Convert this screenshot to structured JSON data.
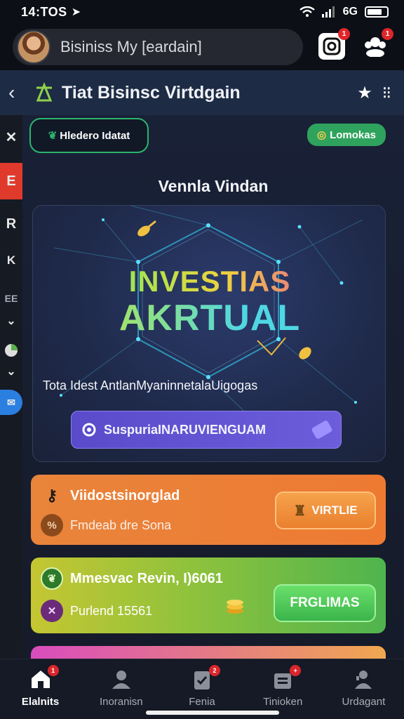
{
  "status": {
    "time": "14:TOS",
    "network": "6G"
  },
  "top_bar": {
    "search_text": "Bisiniss My [eardain]",
    "notif_badge": "1",
    "people_badge": "1"
  },
  "header": {
    "title": "Tiat Bisinsc Virtdgain"
  },
  "left_rail": {
    "items": [
      "K",
      "E",
      "R",
      "K",
      "EE"
    ]
  },
  "chips": {
    "left": "Hledero Idatat",
    "right": "Lomokas"
  },
  "section_title": "Vennla Vindan",
  "hero": {
    "line1": "INVESTIAS",
    "line2": "AKRTUAL",
    "subtitle": "Tota Idest AntlanMyaninnetalaUigogas",
    "button_label": "SuspuriaINARUVIENGUAM"
  },
  "cards": [
    {
      "title": "Viidostsinorglad",
      "subtitle": "Fmdeab dre Sona",
      "button": "VIRTLIE",
      "color": "#ee7a32"
    },
    {
      "title": "Mmesvac Revin, I)6061",
      "subtitle": "Purlend 15561",
      "button": "FRGLIMAS",
      "color": "#8fc23c"
    }
  ],
  "bottom_nav": {
    "tabs": [
      {
        "label": "Elalnits",
        "icon": "home-icon",
        "badge": "1"
      },
      {
        "label": "Inoranisn",
        "icon": "person-icon",
        "badge": ""
      },
      {
        "label": "Fenia",
        "icon": "clipboard-icon",
        "badge": "2"
      },
      {
        "label": "Tinioken",
        "icon": "briefcase-icon",
        "badge": "+"
      },
      {
        "label": "Urdagant",
        "icon": "agent-icon",
        "badge": ""
      }
    ]
  }
}
